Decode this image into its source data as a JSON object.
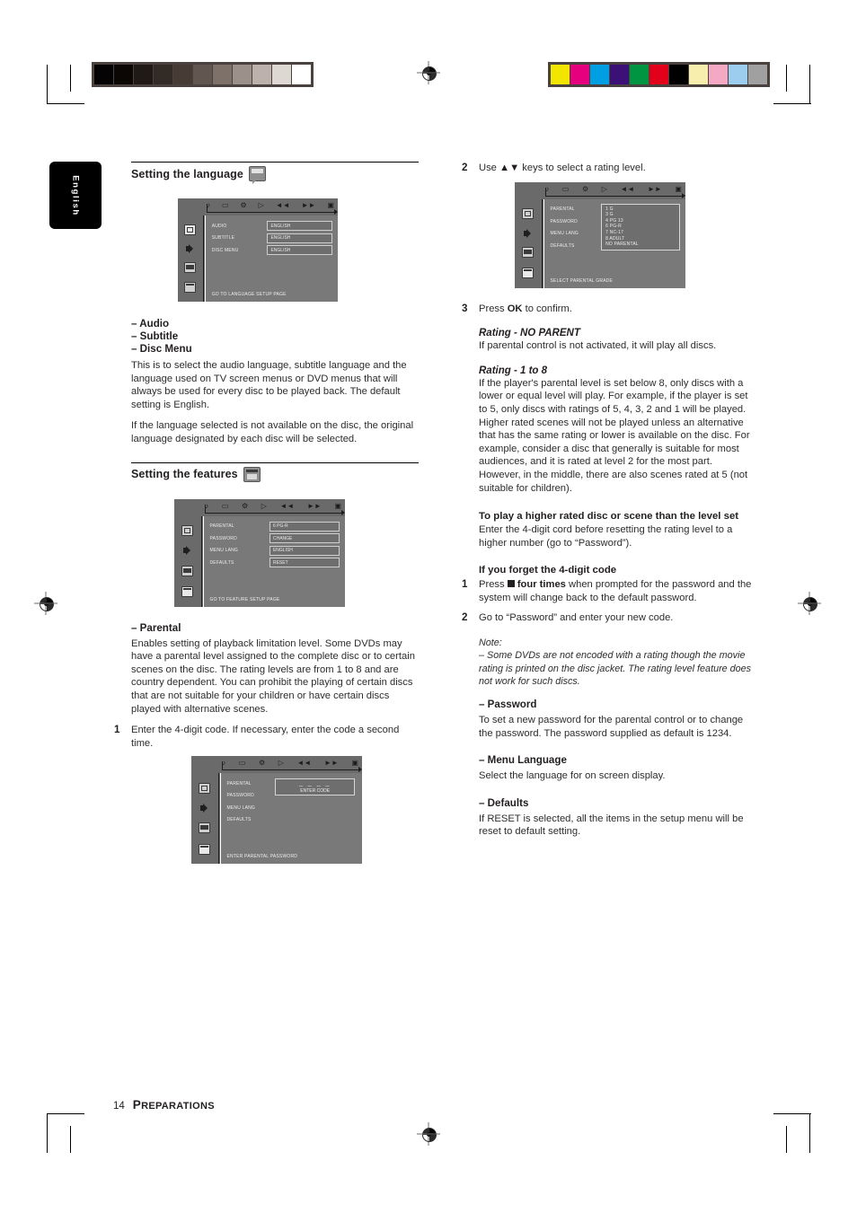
{
  "page": {
    "number": "14",
    "footer_title_first": "P",
    "footer_title_rest": "REPARATIONS",
    "thumb_tab": "English"
  },
  "left_column": {
    "heading_language": "Setting the language",
    "osd_language": {
      "rows": [
        {
          "label": "AUDIO",
          "value": "ENGLISH"
        },
        {
          "label": "SUBTITLE",
          "value": "ENGLISH"
        },
        {
          "label": "DISC MENU",
          "value": "ENGLISH"
        }
      ],
      "footer": "GO TO LANGUAGE SETUP PAGE"
    },
    "bullets": [
      "– Audio",
      "– Subtitle",
      "– Disc Menu"
    ],
    "para_1": "This is to select the audio language, subtitle language and the language used on TV screen menus or DVD menus that will always be used for every disc to be played back.  The default setting is English.",
    "para_2": "If the language selected is not available on the disc, the original language designated by each disc will be selected.",
    "heading_features": "Setting the features",
    "osd_features": {
      "rows": [
        {
          "label": "PARENTAL",
          "value": "6 PG-R"
        },
        {
          "label": "PASSWORD",
          "value": "CHANGE"
        },
        {
          "label": "MENU LANG",
          "value": "ENGLISH"
        },
        {
          "label": "DEFAULTS",
          "value": "RESET"
        }
      ],
      "footer": "GO TO FEATURE SETUP PAGE"
    },
    "parental_heading": "– Parental",
    "parental_para": "Enables setting of playback limitation level. Some DVDs may have a parental level assigned to the complete disc or to certain scenes on the disc.  The rating levels are from 1 to 8 and are country dependent. You can prohibit the playing of certain discs that are not suitable for your children or have certain discs played with alternative scenes.",
    "step_1_num": "1",
    "step_1_text": "Enter the 4-digit code. If necessary, enter the code a second time.",
    "osd_password": {
      "rows": [
        {
          "label": "PARENTAL",
          "value": ""
        },
        {
          "label": "PASSWORD",
          "value": ""
        },
        {
          "label": "MENU LANG",
          "value": ""
        },
        {
          "label": "DEFAULTS",
          "value": ""
        }
      ],
      "code_dashes": "_  _  _  _",
      "code_caption": "ENTER CODE",
      "footer": "ENTER PARENTAL PASSWORD"
    }
  },
  "right_column": {
    "step_2_num": "2",
    "step_2_text_before": "Use ",
    "step_2_keys": "▲▼",
    "step_2_text_after": " keys to select a rating level.",
    "osd_ratings": {
      "rows": [
        {
          "label": "PARENTAL"
        },
        {
          "label": "PASSWORD"
        },
        {
          "label": "MENU LANG"
        },
        {
          "label": "DEFAULTS"
        }
      ],
      "ratings": [
        "1 G",
        "3 G",
        "4 PG 13",
        "6 PG-R",
        "7 NC-17",
        "8 ADULT",
        "NO PARENTAL"
      ],
      "footer": "SELECT PARENTAL GRADE"
    },
    "step_3_num": "3",
    "step_3_before": "Press ",
    "step_3_bold": "OK",
    "step_3_after": " to confirm.",
    "rating_noparent_heading": "Rating - NO PARENT",
    "rating_noparent_body": "If parental control is not activated, it will play all discs.",
    "rating_1to8_heading": "Rating - 1 to 8",
    "rating_1to8_body": "If the player's parental level is set below 8, only discs with a lower or equal level will play. For example, if the player is set to 5, only discs with ratings of 5, 4, 3, 2 and 1 will be played.  Higher rated scenes will not be played unless an alternative that has the same rating or lower is available on the disc. For example, consider a disc that generally is suitable for most audiences, and it is rated at level 2 for the most part. However, in the middle, there are also scenes rated at 5 (not suitable for children).",
    "higher_rated_heading": "To play a higher rated disc or scene than the level set",
    "higher_rated_body": "Enter the 4-digit cord before resetting the rating level to a higher number (go to “Password”).",
    "forget_heading": "If you forget the 4-digit code",
    "forget_step_1_num": "1",
    "forget_step_1_before": "Press ",
    "forget_step_1_bold": "four times",
    "forget_step_1_after": " when prompted for the password and the system will change back to the default password.",
    "forget_step_2_num": "2",
    "forget_step_2_text": "Go to “Password” and enter your new code.",
    "note_label": "Note:",
    "note_body": "–  Some DVDs are not encoded with a rating though the movie rating is printed on the disc jacket. The rating level feature does not work for such discs.",
    "password_heading": "– Password",
    "password_body": "To set a new password for the parental control or to change the password.  The password supplied as default is 1234.",
    "menulang_heading": "– Menu Language",
    "menulang_body": "Select the language for on screen display.",
    "defaults_heading": "– Defaults",
    "defaults_body": "If RESET is selected, all the items in the setup menu will be reset to default setting."
  },
  "print_marks": {
    "gray_wedge": [
      "#050303",
      "#0b0705",
      "#201a17",
      "#332b26",
      "#463c35",
      "#615650",
      "#7d7169",
      "#9c918a",
      "#bcb2ab",
      "#ded8d2",
      "#ffffff"
    ],
    "color_bar": [
      "#f2e500",
      "#e6007e",
      "#009fe3",
      "#3b1178",
      "#009540",
      "#e2001a",
      "#000000",
      "#f7eeae",
      "#f5a8c3",
      "#9ccdee",
      "#a0a0a0"
    ]
  },
  "osd_icon_row": [
    "♪",
    "▭",
    "⚙",
    "▷",
    "◄◄",
    "►►",
    "▣"
  ]
}
